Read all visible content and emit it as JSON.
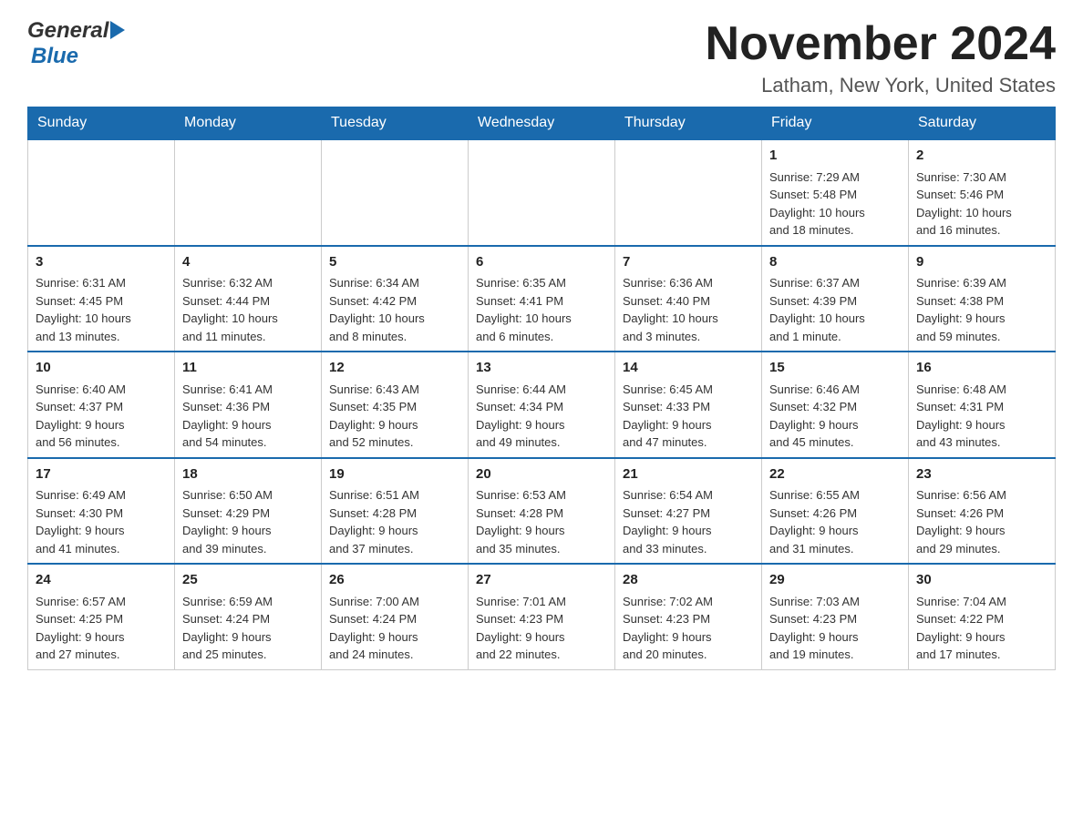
{
  "header": {
    "logo_general": "General",
    "logo_blue": "Blue",
    "month_title": "November 2024",
    "location": "Latham, New York, United States"
  },
  "days_of_week": [
    "Sunday",
    "Monday",
    "Tuesday",
    "Wednesday",
    "Thursday",
    "Friday",
    "Saturday"
  ],
  "weeks": [
    [
      {
        "day": "",
        "info": ""
      },
      {
        "day": "",
        "info": ""
      },
      {
        "day": "",
        "info": ""
      },
      {
        "day": "",
        "info": ""
      },
      {
        "day": "",
        "info": ""
      },
      {
        "day": "1",
        "info": "Sunrise: 7:29 AM\nSunset: 5:48 PM\nDaylight: 10 hours\nand 18 minutes."
      },
      {
        "day": "2",
        "info": "Sunrise: 7:30 AM\nSunset: 5:46 PM\nDaylight: 10 hours\nand 16 minutes."
      }
    ],
    [
      {
        "day": "3",
        "info": "Sunrise: 6:31 AM\nSunset: 4:45 PM\nDaylight: 10 hours\nand 13 minutes."
      },
      {
        "day": "4",
        "info": "Sunrise: 6:32 AM\nSunset: 4:44 PM\nDaylight: 10 hours\nand 11 minutes."
      },
      {
        "day": "5",
        "info": "Sunrise: 6:34 AM\nSunset: 4:42 PM\nDaylight: 10 hours\nand 8 minutes."
      },
      {
        "day": "6",
        "info": "Sunrise: 6:35 AM\nSunset: 4:41 PM\nDaylight: 10 hours\nand 6 minutes."
      },
      {
        "day": "7",
        "info": "Sunrise: 6:36 AM\nSunset: 4:40 PM\nDaylight: 10 hours\nand 3 minutes."
      },
      {
        "day": "8",
        "info": "Sunrise: 6:37 AM\nSunset: 4:39 PM\nDaylight: 10 hours\nand 1 minute."
      },
      {
        "day": "9",
        "info": "Sunrise: 6:39 AM\nSunset: 4:38 PM\nDaylight: 9 hours\nand 59 minutes."
      }
    ],
    [
      {
        "day": "10",
        "info": "Sunrise: 6:40 AM\nSunset: 4:37 PM\nDaylight: 9 hours\nand 56 minutes."
      },
      {
        "day": "11",
        "info": "Sunrise: 6:41 AM\nSunset: 4:36 PM\nDaylight: 9 hours\nand 54 minutes."
      },
      {
        "day": "12",
        "info": "Sunrise: 6:43 AM\nSunset: 4:35 PM\nDaylight: 9 hours\nand 52 minutes."
      },
      {
        "day": "13",
        "info": "Sunrise: 6:44 AM\nSunset: 4:34 PM\nDaylight: 9 hours\nand 49 minutes."
      },
      {
        "day": "14",
        "info": "Sunrise: 6:45 AM\nSunset: 4:33 PM\nDaylight: 9 hours\nand 47 minutes."
      },
      {
        "day": "15",
        "info": "Sunrise: 6:46 AM\nSunset: 4:32 PM\nDaylight: 9 hours\nand 45 minutes."
      },
      {
        "day": "16",
        "info": "Sunrise: 6:48 AM\nSunset: 4:31 PM\nDaylight: 9 hours\nand 43 minutes."
      }
    ],
    [
      {
        "day": "17",
        "info": "Sunrise: 6:49 AM\nSunset: 4:30 PM\nDaylight: 9 hours\nand 41 minutes."
      },
      {
        "day": "18",
        "info": "Sunrise: 6:50 AM\nSunset: 4:29 PM\nDaylight: 9 hours\nand 39 minutes."
      },
      {
        "day": "19",
        "info": "Sunrise: 6:51 AM\nSunset: 4:28 PM\nDaylight: 9 hours\nand 37 minutes."
      },
      {
        "day": "20",
        "info": "Sunrise: 6:53 AM\nSunset: 4:28 PM\nDaylight: 9 hours\nand 35 minutes."
      },
      {
        "day": "21",
        "info": "Sunrise: 6:54 AM\nSunset: 4:27 PM\nDaylight: 9 hours\nand 33 minutes."
      },
      {
        "day": "22",
        "info": "Sunrise: 6:55 AM\nSunset: 4:26 PM\nDaylight: 9 hours\nand 31 minutes."
      },
      {
        "day": "23",
        "info": "Sunrise: 6:56 AM\nSunset: 4:26 PM\nDaylight: 9 hours\nand 29 minutes."
      }
    ],
    [
      {
        "day": "24",
        "info": "Sunrise: 6:57 AM\nSunset: 4:25 PM\nDaylight: 9 hours\nand 27 minutes."
      },
      {
        "day": "25",
        "info": "Sunrise: 6:59 AM\nSunset: 4:24 PM\nDaylight: 9 hours\nand 25 minutes."
      },
      {
        "day": "26",
        "info": "Sunrise: 7:00 AM\nSunset: 4:24 PM\nDaylight: 9 hours\nand 24 minutes."
      },
      {
        "day": "27",
        "info": "Sunrise: 7:01 AM\nSunset: 4:23 PM\nDaylight: 9 hours\nand 22 minutes."
      },
      {
        "day": "28",
        "info": "Sunrise: 7:02 AM\nSunset: 4:23 PM\nDaylight: 9 hours\nand 20 minutes."
      },
      {
        "day": "29",
        "info": "Sunrise: 7:03 AM\nSunset: 4:23 PM\nDaylight: 9 hours\nand 19 minutes."
      },
      {
        "day": "30",
        "info": "Sunrise: 7:04 AM\nSunset: 4:22 PM\nDaylight: 9 hours\nand 17 minutes."
      }
    ]
  ]
}
